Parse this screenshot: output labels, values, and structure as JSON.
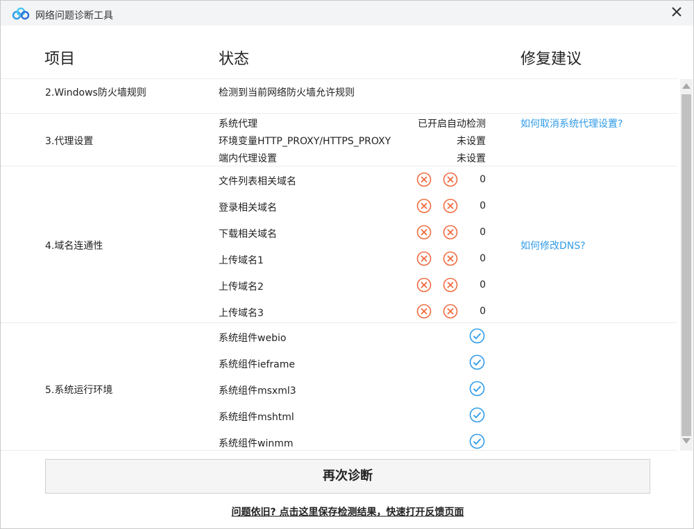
{
  "window": {
    "title": "网络问题诊断工具"
  },
  "header": {
    "item": "项目",
    "status": "状态",
    "advice": "修复建议"
  },
  "rows": {
    "firewall": {
      "title": "2.Windows防火墙规则",
      "status": "检测到当前网络防火墙允许规则"
    },
    "proxy": {
      "title": "3.代理设置",
      "items": [
        {
          "label": "系统代理",
          "value": "已开启自动检测"
        },
        {
          "label": "环境变量HTTP_PROXY/HTTPS_PROXY",
          "value": "未设置"
        },
        {
          "label": "端内代理设置",
          "value": "未设置"
        }
      ],
      "advice": "如何取消系统代理设置?"
    },
    "domain": {
      "title": "4.域名连通性",
      "items": [
        {
          "label": "文件列表相关域名",
          "count": "0"
        },
        {
          "label": "登录相关域名",
          "count": "0"
        },
        {
          "label": "下载相关域名",
          "count": "0"
        },
        {
          "label": "上传域名1",
          "count": "0"
        },
        {
          "label": "上传域名2",
          "count": "0"
        },
        {
          "label": "上传域名3",
          "count": "0"
        }
      ],
      "advice": "如何修改DNS?"
    },
    "env": {
      "title": "5.系统运行环境",
      "items": [
        {
          "label": "系统组件webio"
        },
        {
          "label": "系统组件ieframe"
        },
        {
          "label": "系统组件msxml3"
        },
        {
          "label": "系统组件mshtml"
        },
        {
          "label": "系统组件winmm"
        }
      ]
    }
  },
  "actions": {
    "rediagnose": "再次诊断",
    "feedback": "问题依旧? 点击这里保存检测结果，快速打开反馈页面"
  },
  "colors": {
    "error": "#f06a3e",
    "ok": "#2f9be8",
    "link": "#2f9be8"
  },
  "icons": {
    "error": "x-circle-icon",
    "ok": "check-circle-icon",
    "close": "close-icon",
    "logo": "app-logo-icon"
  }
}
